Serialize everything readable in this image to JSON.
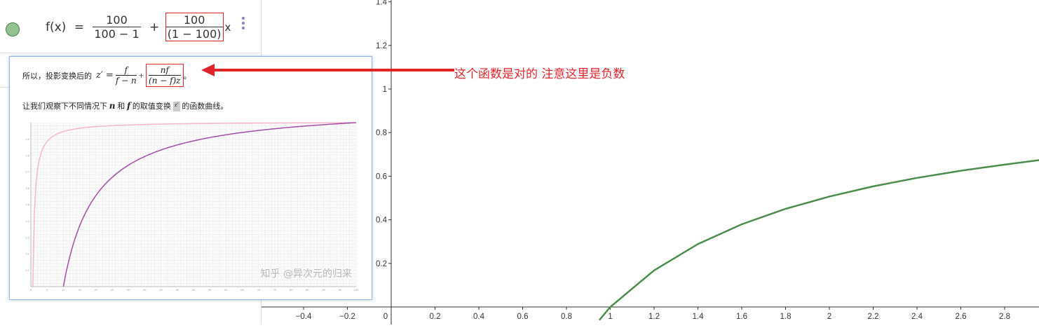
{
  "algebra": {
    "row1": {
      "fx": "f(x)",
      "eq": "=",
      "frac1_num": "100",
      "frac1_den": "100 − 1",
      "plus": "+",
      "frac2_num": "100",
      "frac2_den": "(1 − 100)",
      "x": "x"
    }
  },
  "popup": {
    "line1_prefix": "所以，投影变换后的",
    "line1_z": "z′ =",
    "frac_a_num": "f",
    "frac_a_den": "f − n",
    "plus": "+",
    "frac_b_num": "nf",
    "frac_b_den": "(n − f)z",
    "line1_end": "。",
    "line2_a": "让我们观察下不同情况下",
    "line2_n": "n",
    "line2_and": "和",
    "line2_f": "f",
    "line2_b": "的取值变换",
    "line2_z": "z′",
    "line2_c": "的函数曲线。",
    "watermark": "知乎 @异次元的归来",
    "x_ticks": [
      "0",
      "5",
      "10",
      "15",
      "20",
      "25",
      "30",
      "35",
      "40",
      "45",
      "50",
      "55",
      "60",
      "65",
      "70",
      "75",
      "80",
      "85",
      "90",
      "95",
      "100"
    ],
    "y_ticks": [
      "0.9",
      "0.8",
      "0.7",
      "0.6",
      "0.5",
      "0.4",
      "0.3",
      "0.2",
      "0.1"
    ]
  },
  "annotation": "这个函数是对的  注意这里是负数",
  "colors": {
    "curve": "#4c8c4c",
    "annotation": "#e0252a",
    "popup_curve_dark": "#a24ea6",
    "popup_curve_light": "#f4b6cf"
  },
  "chart_data": {
    "type": "line",
    "x_ticks": [
      "−0.4",
      "−0.2",
      "0",
      "0.2",
      "0.4",
      "0.6",
      "0.8",
      "1",
      "1.2",
      "1.4",
      "1.6",
      "1.8",
      "2",
      "2.2",
      "2.4",
      "2.6",
      "2.8"
    ],
    "y_ticks": [
      "0.2",
      "0.4",
      "0.6",
      "0.8",
      "1",
      "1.2",
      "1.4"
    ],
    "xlim": [
      -0.58,
      2.97
    ],
    "ylim": [
      -0.08,
      1.41
    ],
    "series": [
      {
        "x": [
          0.95,
          1.0,
          1.2,
          1.4,
          1.6,
          1.8,
          2.0,
          2.2,
          2.4,
          2.6,
          2.8,
          2.97
        ],
        "y": [
          -0.06,
          0.0,
          0.1679,
          0.2886,
          0.3794,
          0.4502,
          0.5069,
          0.5534,
          0.5922,
          0.625,
          0.6532,
          0.6752
        ]
      }
    ]
  }
}
